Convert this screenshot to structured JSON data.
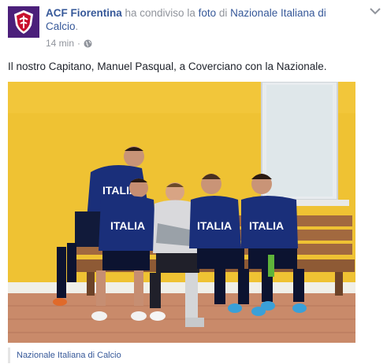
{
  "post": {
    "author": "ACF Fiorentina",
    "action_1": "ha condiviso la",
    "object": "foto",
    "action_2": "di",
    "source_page": "Nazionale Italiana di Calcio",
    "source_tail": ".",
    "timestamp": "14 min",
    "separator": "·",
    "privacy_icon": "globe-icon",
    "menu_icon": "chevron-down-icon",
    "caption": "Il nostro Capitano, Manuel Pasqual, a Coverciano con la Nazionale.",
    "photo_icon": "team-photo",
    "jersey_text": "ITALIA",
    "attribution": "Nazionale Italiana di Calcio"
  },
  "colors": {
    "link": "#365899",
    "muted": "#90949c",
    "crest_purple": "#4b1f7a",
    "wall_yellow": "#efc233",
    "jersey_blue": "#1a2f7a"
  }
}
